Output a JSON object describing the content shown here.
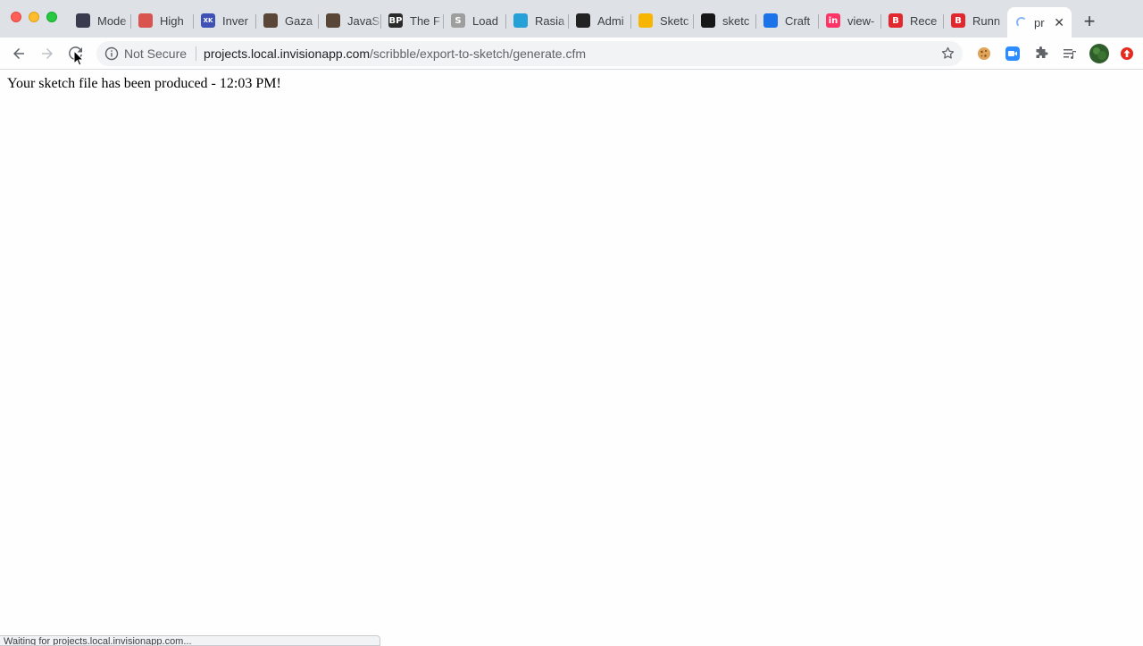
{
  "tabs": [
    {
      "title": "Mode",
      "icon": "modern-diamond-icon",
      "color": "#3b3b4f"
    },
    {
      "title": "High",
      "icon": "highcharts-icon",
      "color": "#d9534f"
    },
    {
      "title": "Inver",
      "icon": "xkcd-icon",
      "color": "#3f51b5"
    },
    {
      "title": "Gaza",
      "icon": "person-avatar-icon",
      "color": "#5a4636"
    },
    {
      "title": "JavaS",
      "icon": "person-avatar-icon",
      "color": "#5a4636"
    },
    {
      "title": "The F",
      "icon": "bp-icon",
      "color": "#2b2b2b"
    },
    {
      "title": "Load",
      "icon": "s-letter-icon",
      "color": "#9e9e9e"
    },
    {
      "title": "Rasia",
      "icon": "paw-icon",
      "color": "#26a1d8"
    },
    {
      "title": "Admi",
      "icon": "tree-icon",
      "color": "#222222"
    },
    {
      "title": "Sketc",
      "icon": "sketch-diamond-icon",
      "color": "#f7b500"
    },
    {
      "title": "sketc",
      "icon": "github-icon",
      "color": "#181717"
    },
    {
      "title": "Craft",
      "icon": "craft-icon",
      "color": "#1a73e8"
    },
    {
      "title": "view-",
      "icon": "invision-icon",
      "color": "#ff3366"
    },
    {
      "title": "Rece",
      "icon": "b-letter-icon",
      "color": "#e0282e"
    },
    {
      "title": "Runn",
      "icon": "b-letter-icon",
      "color": "#e0282e"
    }
  ],
  "tab_glyphs": {
    "s-letter-icon": "S",
    "b-letter-icon": "B",
    "xkcd-icon": "XKCD",
    "invision-icon": "in",
    "bp-icon": "BP"
  },
  "active_tab": {
    "title": "pr",
    "close": "✕"
  },
  "new_tab_label": "+",
  "omnibox": {
    "security_label": "Not Secure",
    "url_host": "projects.local.invisionapp.com",
    "url_path": "/scribble/export-to-sketch/generate.cfm"
  },
  "page": {
    "message": "Your sketch file has been produced - 12:03 PM!"
  },
  "status_bar": {
    "text": "Waiting for projects.local.invisionapp.com..."
  },
  "colors": {
    "tabstrip_bg": "#dee1e6",
    "toolbar_bg": "#fefefe",
    "page_bg": "#fefefe"
  }
}
